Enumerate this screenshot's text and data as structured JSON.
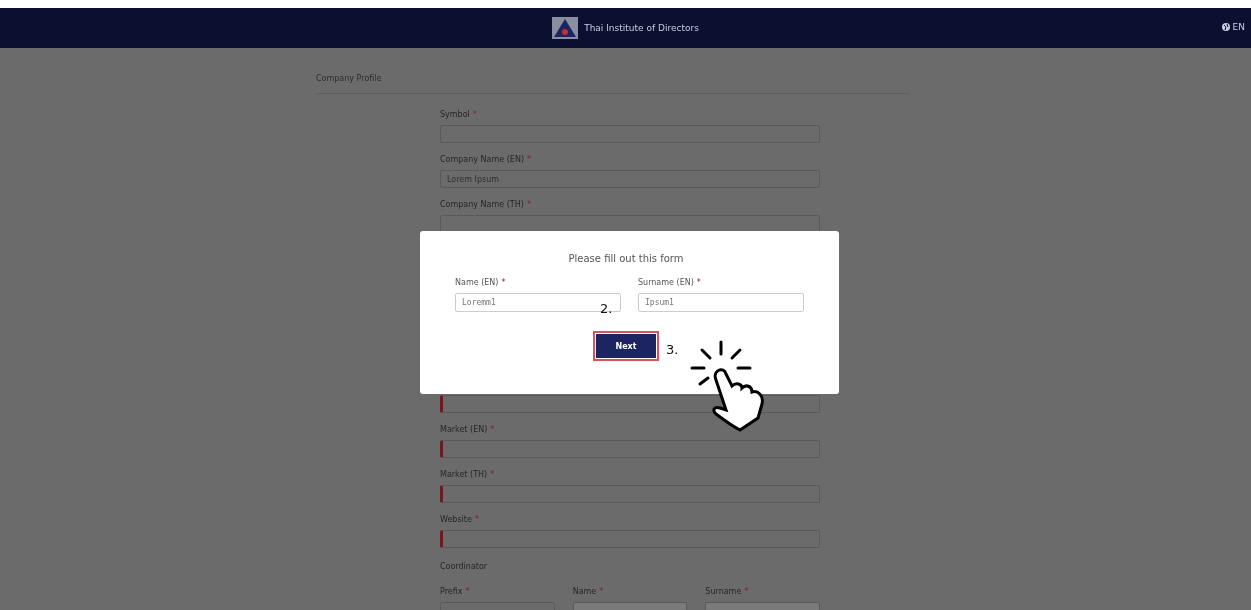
{
  "header": {
    "brand": "Thai Institute of Directors",
    "language": "EN"
  },
  "page_title": "Company Profile",
  "fields": [
    {
      "label": "Symbol",
      "mark": "*"
    },
    {
      "label": "Company Name (EN)",
      "mark": "*",
      "value": "Lorem Ipsum"
    },
    {
      "label": "Company Name (TH)",
      "mark": "*"
    }
  ],
  "fields_below": [
    {
      "invalid": true
    },
    {
      "label": "Market (EN)",
      "mark": "*",
      "invalid": true
    },
    {
      "label": "Market (TH)",
      "mark": "*",
      "invalid": true
    },
    {
      "label": "Website",
      "mark": "*",
      "invalid": true
    }
  ],
  "coordinator": {
    "title": "Coordinator",
    "fields": [
      {
        "label": "Prefix",
        "mark": "*",
        "disabled": false
      },
      {
        "label": "Name",
        "mark": "*",
        "disabled": true
      },
      {
        "label": "Surname",
        "mark": "*",
        "disabled": true
      }
    ]
  },
  "modal": {
    "title": "Please fill out this form",
    "fields": [
      {
        "label": "Name (EN)",
        "mark": "*",
        "value": "Loremm1"
      },
      {
        "label": "Surname (EN)",
        "mark": "*",
        "value": "Ipsum1"
      }
    ],
    "button": "Next"
  },
  "annotations": [
    {
      "text": "2."
    },
    {
      "text": "3."
    }
  ]
}
